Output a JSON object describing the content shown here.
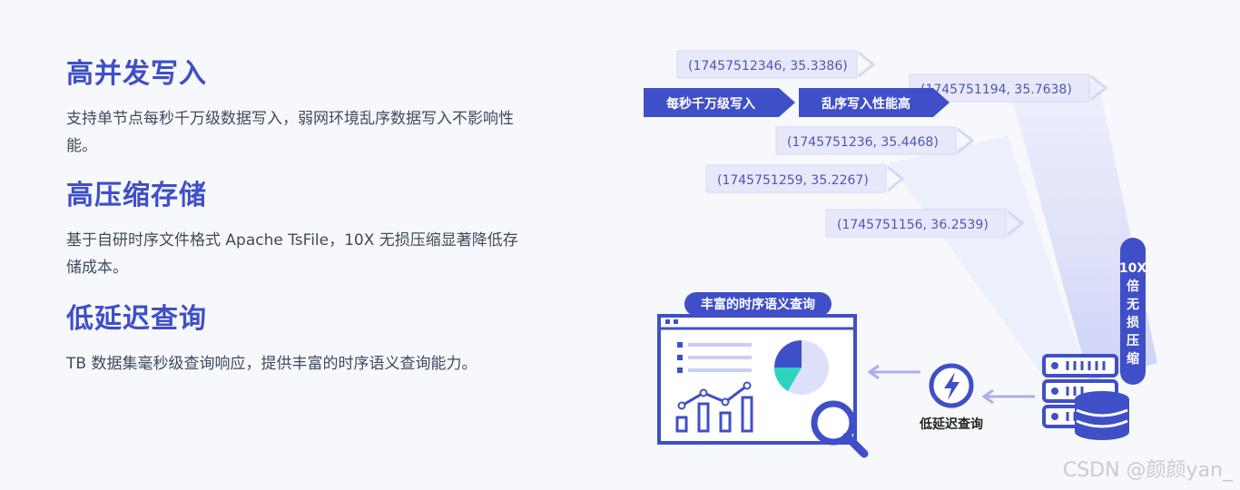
{
  "features": [
    {
      "title": "高并发写入",
      "desc": "支持单节点每秒千万级数据写入，弱网环境乱序数据写入不影响性能。"
    },
    {
      "title": "高压缩存储",
      "desc": "基于自研时序文件格式 Apache TsFile，10X 无损压缩显著降低存储成本。"
    },
    {
      "title": "低延迟查询",
      "desc": "TB 数据集毫秒级查询响应，提供丰富的时序语义查询能力。"
    }
  ],
  "diagram": {
    "data_points": [
      "(17457512346, 35.3386)",
      "(1745751194, 35.7638)",
      "(1745751236, 35.4468)",
      "(1745751259, 35.2267)",
      "(1745751156, 36.2539)"
    ],
    "write_label": "每秒千万级写入",
    "disorder_label": "乱序写入性能高",
    "compress_label": [
      "10X",
      "倍",
      "无",
      "损",
      "压",
      "缩"
    ],
    "query_panel_label": "丰富的时序语义查询",
    "latency_label": "低延迟查询"
  },
  "watermark": "CSDN @颜颜yan_",
  "colors": {
    "accent": "#3f4fc8",
    "dark": "#4352c4",
    "light": "#e6e8fb"
  }
}
